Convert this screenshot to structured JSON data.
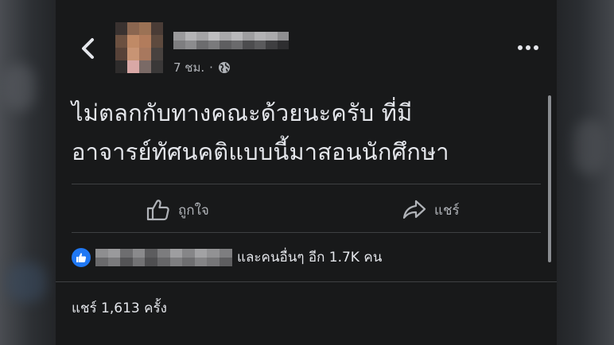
{
  "header": {
    "author_name": "",
    "timestamp": "7 ชม.",
    "separator": "·",
    "audience_icon": "globe-icon",
    "back_icon": "chevron-left-icon",
    "menu_icon": "more-horizontal-icon"
  },
  "post": {
    "lines": [
      "ไม่ตลกกับทางคณะด้วยนะครับ ที่มี",
      "อาจารย์ทัศนคติแบบนี้มาสอนนักศึกษา"
    ]
  },
  "actions": {
    "like_label": "ถูกใจ",
    "like_icon": "thumbs-up-icon",
    "share_label": "แชร์",
    "share_icon": "share-arrow-icon"
  },
  "reactions": {
    "icon": "like-reaction-icon",
    "summary": "และคนอื่นๆ อีก 1.7K คน"
  },
  "shares": {
    "text": "แชร์ 1,613 ครั้ง"
  },
  "colors": {
    "background": "#18191a",
    "text_primary": "#e4e6eb",
    "text_secondary": "#b0b3b8",
    "divider": "#3e4042",
    "like_blue": "#2078f4"
  }
}
